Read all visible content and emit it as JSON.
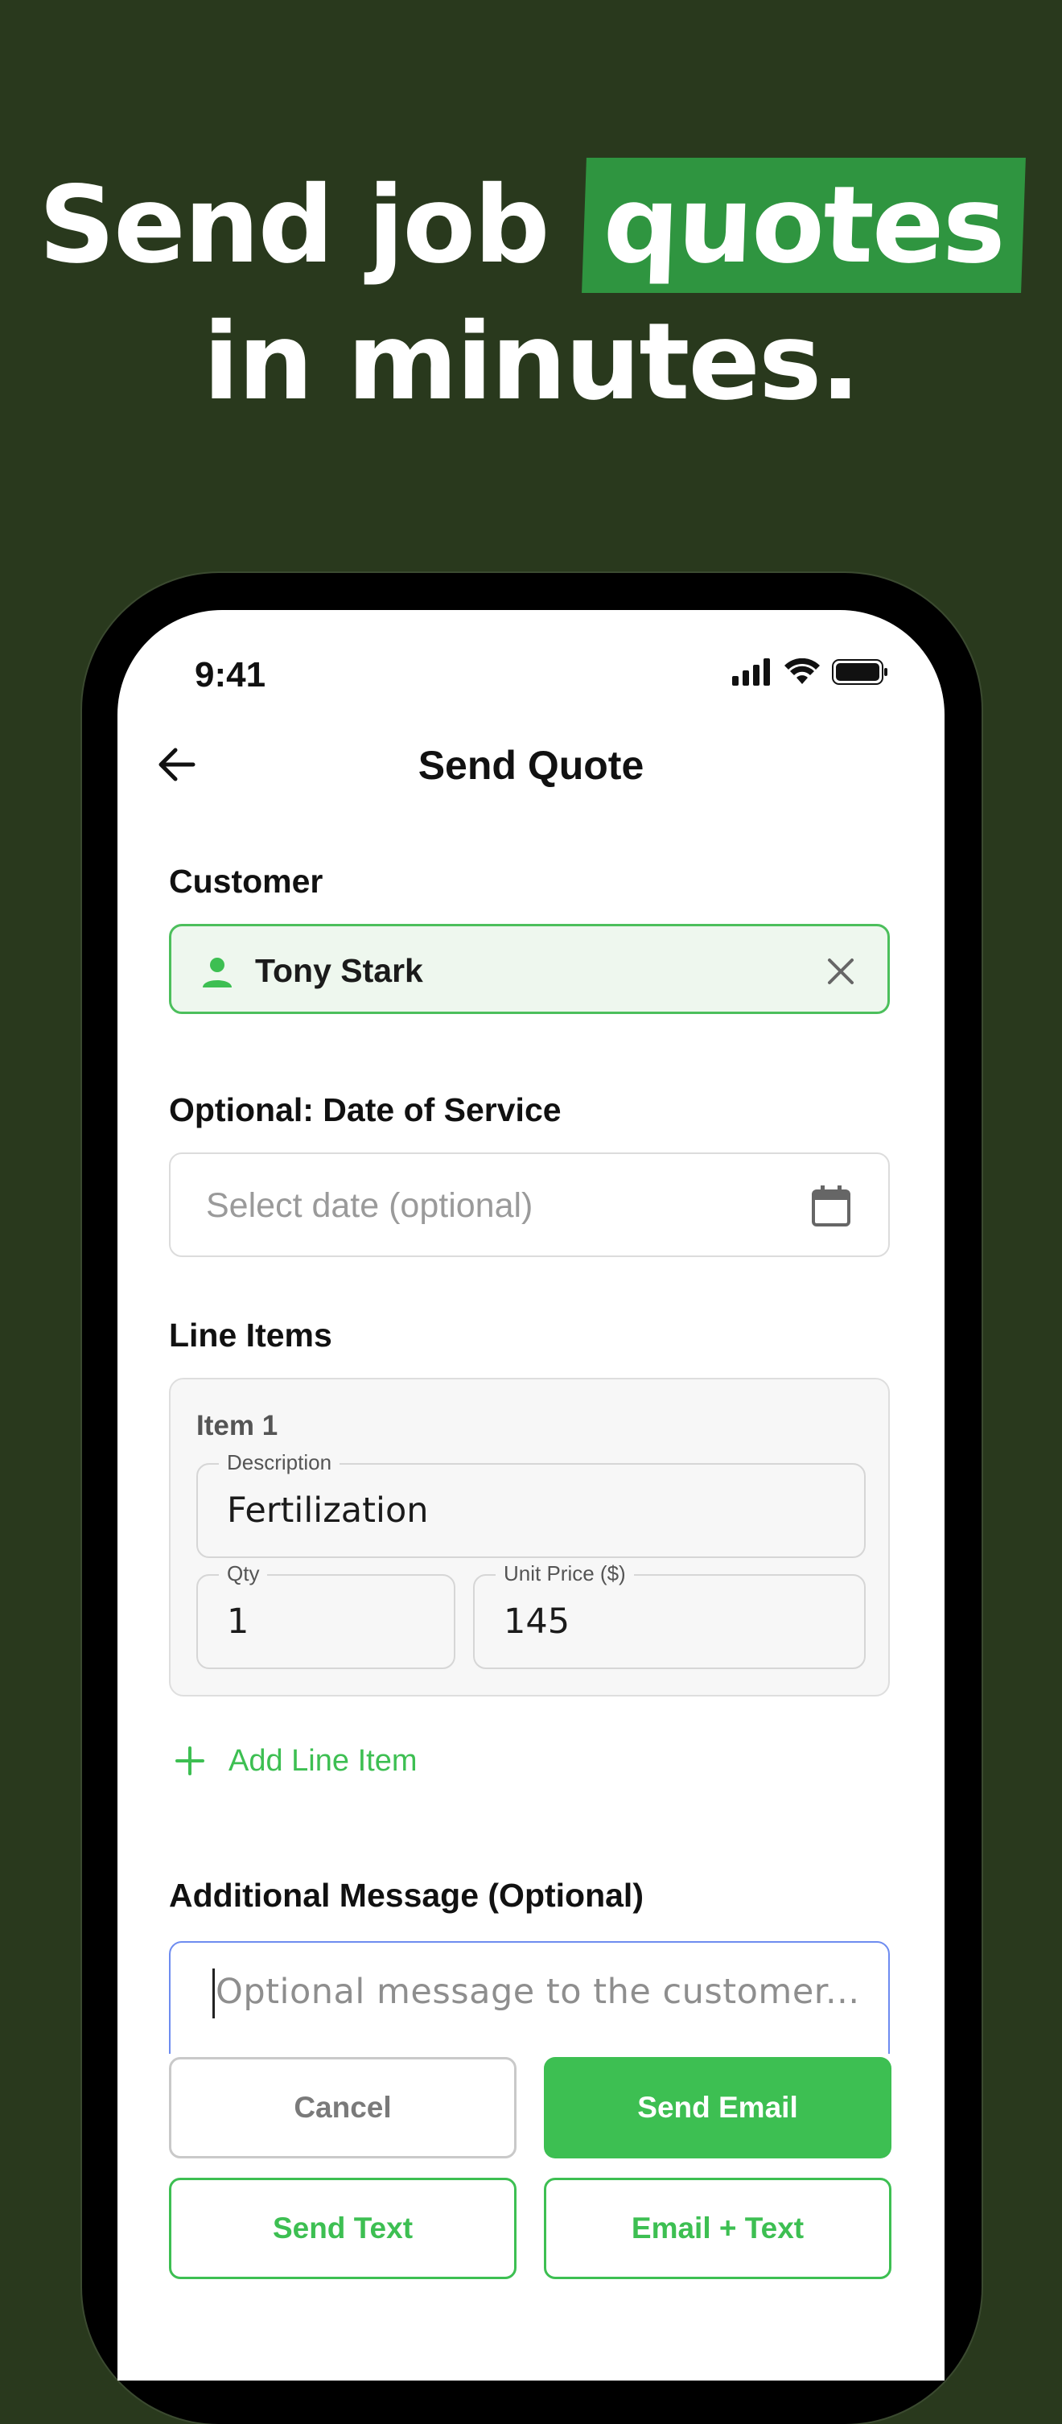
{
  "headline": {
    "line1_prefix": "Send job",
    "line1_highlight": "quotes",
    "line2": "in minutes."
  },
  "status_bar": {
    "time": "9:41",
    "icons": [
      "cellular-signal-icon",
      "wifi-icon",
      "battery-icon"
    ]
  },
  "nav": {
    "back_icon": "arrow-left-icon",
    "title": "Send Quote"
  },
  "customer": {
    "label": "Customer",
    "value": "Tony Stark",
    "icon": "person-icon",
    "clear_icon": "close-icon"
  },
  "date_of_service": {
    "label": "Optional: Date of Service",
    "placeholder": "Select date (optional)",
    "icon": "calendar-icon"
  },
  "line_items": {
    "label": "Line Items",
    "items": [
      {
        "title": "Item 1",
        "description_label": "Description",
        "description": "Fertilization",
        "qty_label": "Qty",
        "qty": "1",
        "unit_price_label": "Unit Price ($)",
        "unit_price": "145"
      }
    ],
    "add_label": "Add Line Item",
    "add_icon": "plus-icon"
  },
  "message": {
    "label": "Additional Message (Optional)",
    "placeholder": "Optional message to the customer..."
  },
  "actions": {
    "cancel": "Cancel",
    "send_email": "Send Email",
    "send_text": "Send Text",
    "email_text": "Email + Text"
  },
  "colors": {
    "background": "#29391d",
    "highlight": "#2f9540",
    "accent": "#3dbf52",
    "focus_border": "#6e8cf0"
  }
}
